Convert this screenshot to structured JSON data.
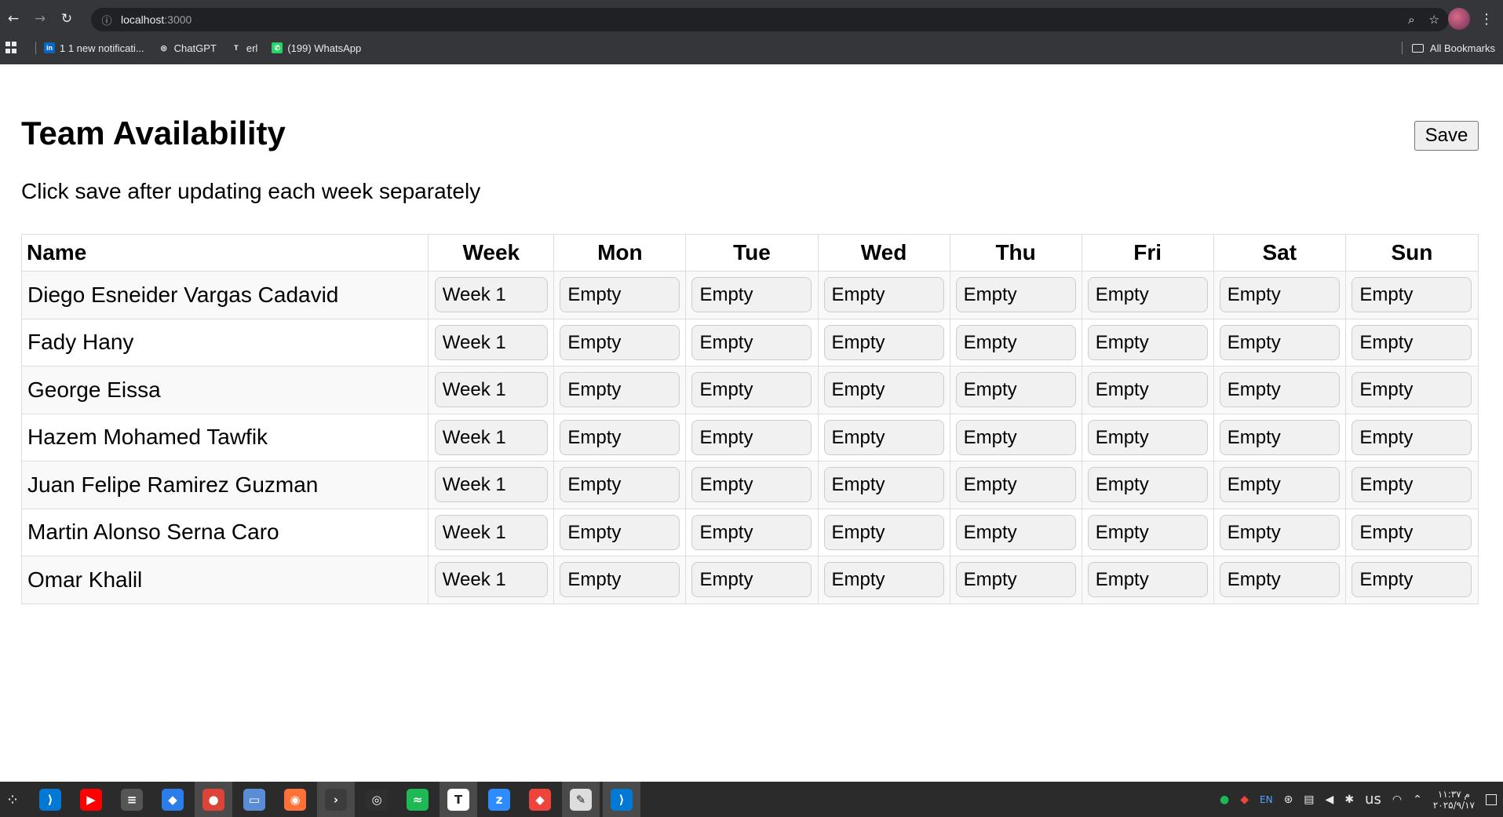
{
  "browser": {
    "url_host": "localhost",
    "url_port": ":3000",
    "bookmarks": [
      {
        "label": "1 1 new notificati...",
        "icon": "linkedin-icon",
        "color": "#0a66c2",
        "glyph": "in"
      },
      {
        "label": "ChatGPT",
        "icon": "chatgpt-icon",
        "color": "#35363a",
        "glyph": "◎"
      },
      {
        "label": "erl",
        "icon": "erl-icon",
        "color": "#35363a",
        "glyph": "T"
      },
      {
        "label": "(199) WhatsApp",
        "icon": "whatsapp-icon",
        "color": "#25d366",
        "glyph": "✆"
      }
    ],
    "all_bookmarks": "All Bookmarks"
  },
  "page": {
    "title": "Team Availability",
    "save_label": "Save",
    "subtitle": "Click save after updating each week separately"
  },
  "table": {
    "headers": {
      "name": "Name",
      "week": "Week",
      "days": [
        "Mon",
        "Tue",
        "Wed",
        "Thu",
        "Fri",
        "Sat",
        "Sun"
      ]
    },
    "rows": [
      {
        "name": "Diego Esneider Vargas Cadavid",
        "week": "Week 1",
        "days": [
          "Empty",
          "Empty",
          "Empty",
          "Empty",
          "Empty",
          "Empty",
          "Empty"
        ]
      },
      {
        "name": "Fady Hany",
        "week": "Week 1",
        "days": [
          "Empty",
          "Empty",
          "Empty",
          "Empty",
          "Empty",
          "Empty",
          "Empty"
        ]
      },
      {
        "name": "George Eissa",
        "week": "Week 1",
        "days": [
          "Empty",
          "Empty",
          "Empty",
          "Empty",
          "Empty",
          "Empty",
          "Empty"
        ]
      },
      {
        "name": "Hazem Mohamed Tawfik",
        "week": "Week 1",
        "days": [
          "Empty",
          "Empty",
          "Empty",
          "Empty",
          "Empty",
          "Empty",
          "Empty"
        ]
      },
      {
        "name": "Juan Felipe Ramirez Guzman",
        "week": "Week 1",
        "days": [
          "Empty",
          "Empty",
          "Empty",
          "Empty",
          "Empty",
          "Empty",
          "Empty"
        ]
      },
      {
        "name": "Martin Alonso Serna Caro",
        "week": "Week 1",
        "days": [
          "Empty",
          "Empty",
          "Empty",
          "Empty",
          "Empty",
          "Empty",
          "Empty"
        ]
      },
      {
        "name": "Omar Khalil",
        "week": "Week 1",
        "days": [
          "Empty",
          "Empty",
          "Empty",
          "Empty",
          "Empty",
          "Empty",
          "Empty"
        ]
      }
    ]
  },
  "taskbar": {
    "apps": [
      {
        "name": "vscode-icon",
        "color": "#0078d4",
        "glyph": "⟩"
      },
      {
        "name": "youtube-icon",
        "color": "#ff0000",
        "glyph": "▶"
      },
      {
        "name": "settings-icon",
        "color": "#555555",
        "glyph": "≡"
      },
      {
        "name": "store-icon",
        "color": "#2b7de9",
        "glyph": "◆"
      },
      {
        "name": "chrome-icon",
        "color": "#db4437",
        "glyph": "●",
        "active": true
      },
      {
        "name": "files-icon",
        "color": "#5a8dd6",
        "glyph": "▭"
      },
      {
        "name": "firefox-icon",
        "color": "#ff7139",
        "glyph": "◉"
      },
      {
        "name": "terminal-icon",
        "color": "#3c3c3c",
        "glyph": "›",
        "active": true
      },
      {
        "name": "obs-icon",
        "color": "#2f2f2f",
        "glyph": "◎"
      },
      {
        "name": "spotify-icon",
        "color": "#1db954",
        "glyph": "≈"
      },
      {
        "name": "typora-icon",
        "color": "#ffffff",
        "glyph": "T",
        "active": true
      },
      {
        "name": "zoom-icon",
        "color": "#2d8cff",
        "glyph": "z"
      },
      {
        "name": "anydesk-icon",
        "color": "#ef443b",
        "glyph": "◆"
      },
      {
        "name": "editor-icon",
        "color": "#dddddd",
        "glyph": "✎",
        "active": true
      },
      {
        "name": "vscode-alt-icon",
        "color": "#0078d4",
        "glyph": "⟩",
        "active": true
      }
    ],
    "tray": {
      "lang": "EN",
      "keyboard": "us",
      "time": "۱۱:۳۷ م",
      "date": "۲۰۲۵/۹/۱۷"
    }
  }
}
